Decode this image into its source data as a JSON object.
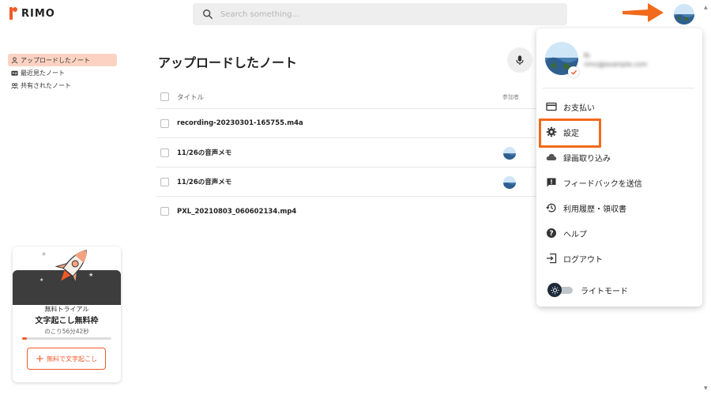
{
  "app": {
    "logo_text": "RIMO"
  },
  "search": {
    "placeholder": "Search something..."
  },
  "sidebar": {
    "items": [
      {
        "label": "アップロードしたノート",
        "icon": "person-icon"
      },
      {
        "label": "最近見たノート",
        "icon": "id-card-icon"
      },
      {
        "label": "共有されたノート",
        "icon": "people-icon"
      }
    ]
  },
  "promo": {
    "subtitle": "無料トライアル",
    "title": "文字起こし無料枠",
    "remaining": "のこり56分42秒",
    "progress_fraction": 0.05,
    "button_label": "無料で文字起こし",
    "button_icon": "plus-icon"
  },
  "main": {
    "title": "アップロードしたノート",
    "mic_icon": "microphone-icon",
    "table": {
      "column_title": "タイトル",
      "column_participants": "参加者",
      "rows": [
        {
          "name": "recording-20230301-165755.m4a",
          "has_participant": false
        },
        {
          "name": "11/26の音声メモ",
          "has_participant": true
        },
        {
          "name": "11/26の音声メモ",
          "has_participant": true
        },
        {
          "name": "PXL_20210803_060602134.mp4",
          "has_participant": false
        }
      ]
    }
  },
  "dropdown": {
    "name_blurred": "Ri",
    "email_blurred": "rimo@example.com",
    "items": [
      {
        "label": "お支払い",
        "icon": "credit-card-icon"
      },
      {
        "label": "設定",
        "icon": "gear-icon"
      },
      {
        "label": "録画取り込み",
        "icon": "cloud-icon"
      },
      {
        "label": "フィードバックを送信",
        "icon": "feedback-icon"
      },
      {
        "label": "利用履歴・領収書",
        "icon": "history-icon"
      },
      {
        "label": "ヘルプ",
        "icon": "help-icon"
      },
      {
        "label": "ログアウト",
        "icon": "logout-icon"
      }
    ],
    "theme_toggle_label": "ライトモード",
    "theme_icon": "sun-icon"
  },
  "colors": {
    "accent": "#f05a28",
    "annotation": "#f26a1b",
    "active_nav_bg": "#fcd3c2",
    "promo_dark": "#3d3d3d"
  }
}
